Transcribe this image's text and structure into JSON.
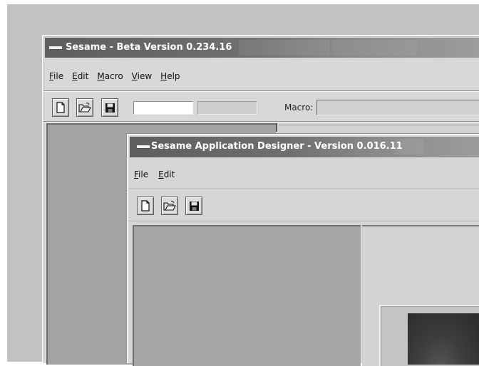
{
  "main_window": {
    "title": "Sesame - Beta Version 0.234.16",
    "menu": [
      {
        "mnemonic": "F",
        "rest": "ile"
      },
      {
        "mnemonic": "E",
        "rest": "dit"
      },
      {
        "mnemonic": "M",
        "rest": "acro"
      },
      {
        "mnemonic": "V",
        "rest": "iew"
      },
      {
        "mnemonic": "H",
        "rest": "elp"
      }
    ],
    "toolbar": {
      "buttons": [
        "new-file-icon",
        "open-folder-icon",
        "save-disk-icon"
      ],
      "macro_label": "Macro:",
      "macro_value": ""
    }
  },
  "designer_window": {
    "title": "Sesame Application Designer - Version 0.016.11",
    "menu": [
      {
        "mnemonic": "F",
        "rest": "ile"
      },
      {
        "mnemonic": "E",
        "rest": "dit"
      }
    ],
    "toolbar": {
      "buttons": [
        "new-file-icon",
        "open-folder-icon",
        "save-disk-icon"
      ]
    }
  }
}
